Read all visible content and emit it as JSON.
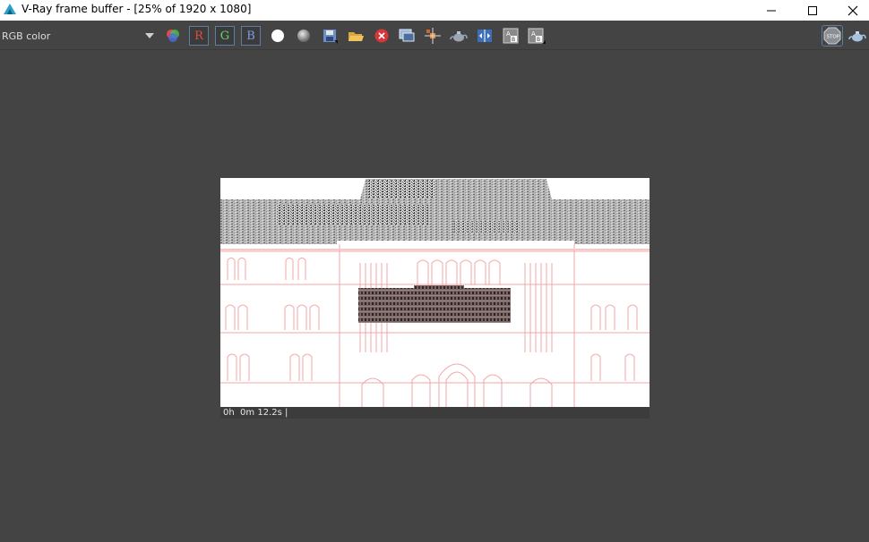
{
  "window": {
    "title": "V-Ray frame buffer - [25% of 1920 x 1080]"
  },
  "toolbar": {
    "channel_value": "RGB color",
    "red_label": "R",
    "green_label": "G",
    "blue_label": "B",
    "stop_label": "STOP"
  },
  "status": {
    "render_time": "0h  0m 12.2s |"
  },
  "colors": {
    "accent": "#5b7fa0",
    "background": "#444444",
    "render_bg": "#ffffff",
    "sketch_lines": "#f2a0a0",
    "facade_brick": "#6e5a5a"
  }
}
